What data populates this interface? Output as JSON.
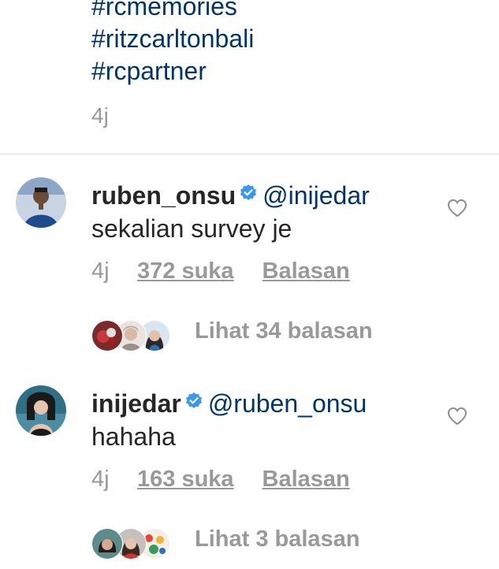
{
  "caption": {
    "hashtags": [
      "#rcmemories",
      "#ritzcarltonbali",
      "#rcpartner"
    ],
    "time": "4j"
  },
  "comments": [
    {
      "username": "ruben_onsu",
      "mention": "@inijedar",
      "text": "sekalian survey je",
      "time": "4j",
      "likes": "372 suka",
      "reply": "Balasan",
      "view_replies": "Lihat 34 balasan",
      "avatar_icon": "person-avatar",
      "like_icon": "heart-outline-icon",
      "verified_icon": "verified-badge-icon"
    },
    {
      "username": "inijedar",
      "mention": "@ruben_onsu",
      "text": "hahaha",
      "time": "4j",
      "likes": "163 suka",
      "reply": "Balasan",
      "view_replies": "Lihat 3 balasan",
      "avatar_icon": "person-avatar",
      "like_icon": "heart-outline-icon",
      "verified_icon": "verified-badge-icon"
    }
  ],
  "colors": {
    "hashtag": "#003569",
    "verified": "#3897f0",
    "muted": "#999999",
    "text": "#262626",
    "divider": "#dbdbdb"
  }
}
